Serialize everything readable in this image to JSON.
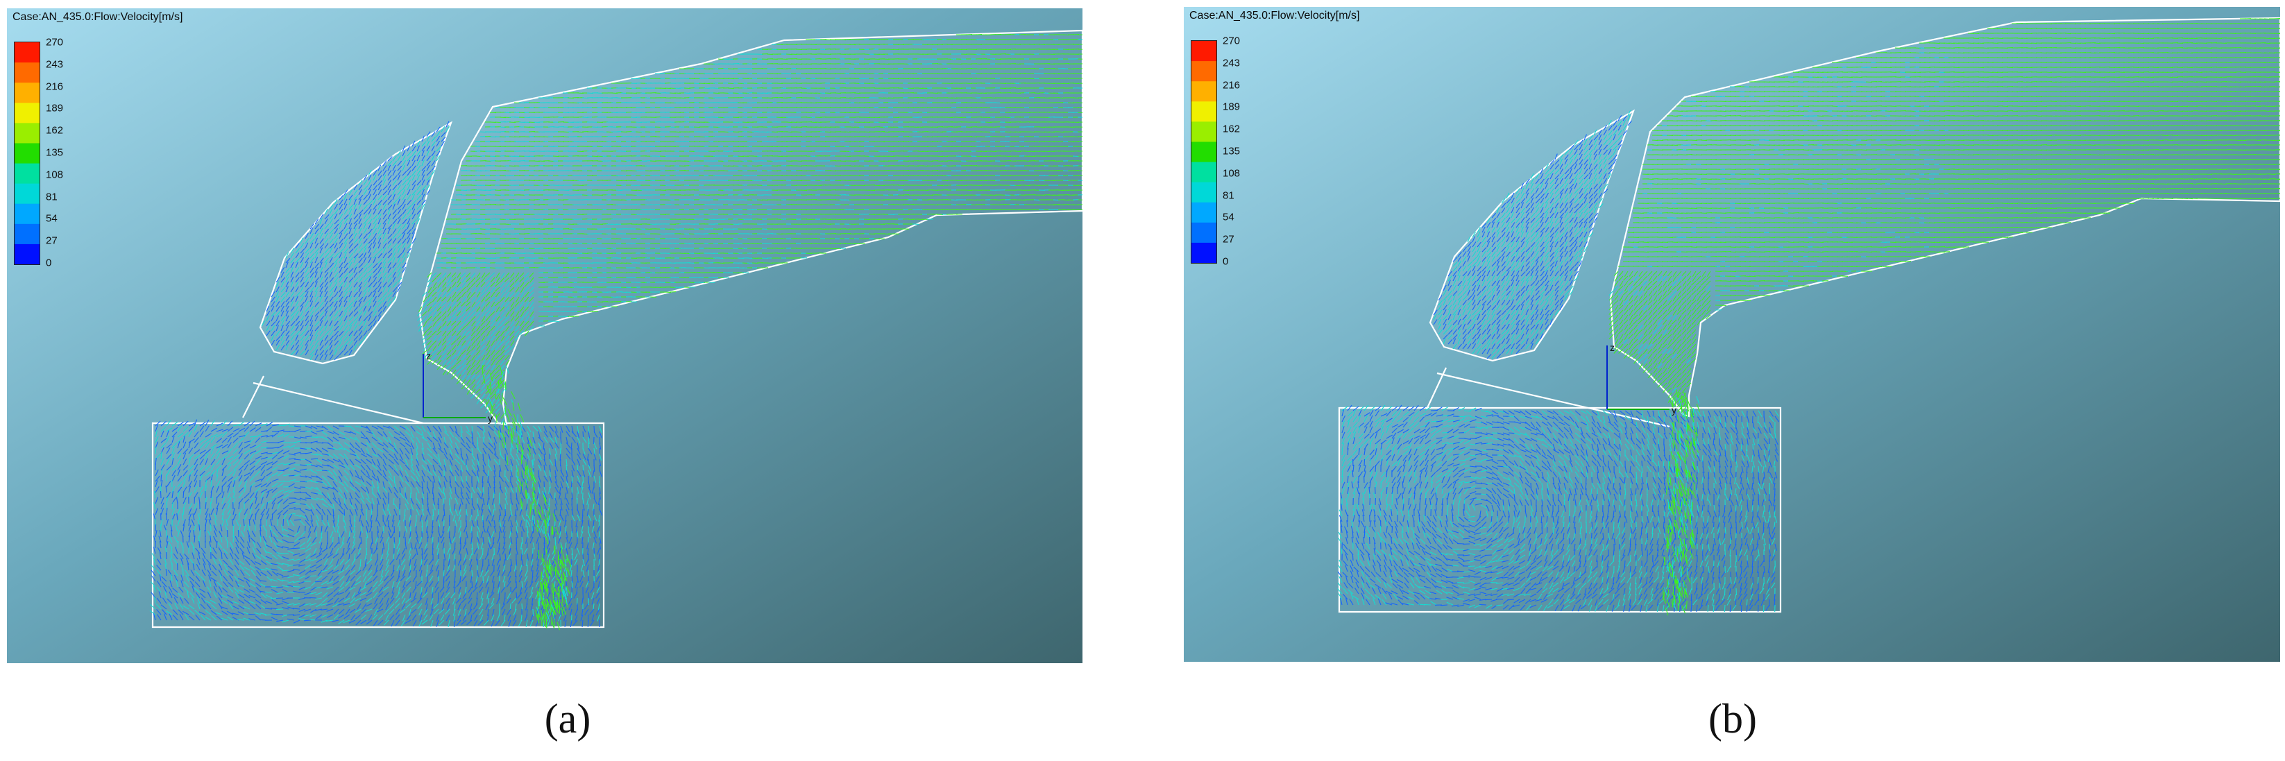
{
  "panels": [
    {
      "caption": "(a)",
      "case_title": "Case:AN_435.0:Flow:Velocity[m/s]",
      "variant": "a"
    },
    {
      "caption": "(b)",
      "case_title": "Case:AN_435.0:Flow:Velocity[m/s]",
      "variant": "b"
    }
  ],
  "legend": {
    "ticks": [
      "270",
      "243",
      "216",
      "189",
      "162",
      "135",
      "108",
      "81",
      "54",
      "27",
      "0"
    ],
    "colors": [
      "#ff1a00",
      "#ff6a00",
      "#ffb000",
      "#f0f000",
      "#9aee00",
      "#22dd00",
      "#00e0a0",
      "#00d8d8",
      "#00a8ff",
      "#0070ff",
      "#0010ff"
    ]
  },
  "axis_labels": {
    "z": "z",
    "y": "y"
  },
  "colors": {
    "background_light": "#9fd6ea",
    "background_dark": "#3f6a72",
    "outline": "#ffffff",
    "slow_vector": "#1464ff",
    "mid_vector": "#14dcd2",
    "fast_vector": "#3ef01e"
  }
}
